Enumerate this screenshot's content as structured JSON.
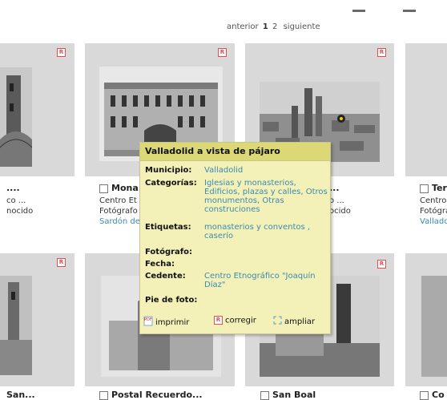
{
  "pager": {
    "prev": "anterior",
    "pages": [
      "1",
      "2"
    ],
    "next": "siguiente"
  },
  "cards_top": [
    {
      "title": "....",
      "line1": "co ...",
      "line2": "nocido",
      "line3": ""
    },
    {
      "title": "Mona",
      "line1": "Centro Et",
      "line2": "Fotógrafo",
      "line3": "Sardón de"
    },
    {
      "title": "...",
      "line1": "o ...",
      "line2": "ocido",
      "line3": ""
    },
    {
      "title": "Ter",
      "line1": "Centro",
      "line2": "Fotógra",
      "line3": "Vallado"
    }
  ],
  "cards_bottom": [
    {
      "title": "San..."
    },
    {
      "title": "Postal Recuerdo..."
    },
    {
      "title": "San Boal"
    },
    {
      "title": "Co"
    }
  ],
  "badge": "R",
  "popup": {
    "title": "Valladolid a vista de pájaro",
    "fields": [
      {
        "label": "Municipio:",
        "value": "Valladolid"
      },
      {
        "label": "Categorías:",
        "value": "Iglesias y monasterios, Edificios, plazas y calles, Otros monumentos, Otras construciones"
      },
      {
        "label": "Etiquetas:",
        "value": "monasterios y conventos , caserío"
      },
      {
        "label": "Fotógrafo:",
        "value": ""
      },
      {
        "label": "Fecha:",
        "value": ""
      },
      {
        "label": "Cedente:",
        "value": "Centro Etnográfico \"Joaquín Díaz\""
      },
      {
        "label": "Pie de foto:",
        "value": ""
      }
    ],
    "actions": {
      "print": "imprimir",
      "correct": "corregir",
      "enlarge": "ampliar"
    },
    "pdf_label": "PDF"
  },
  "colors": {
    "link": "#3a8ab0",
    "popup_bg": "#f3f1b8",
    "popup_header": "#dcd875",
    "tile": "#d9d9d9",
    "badge": "#e05050"
  },
  "icons": [
    "pdf-icon",
    "r-badge-icon",
    "expand-icon",
    "checkbox-icon"
  ]
}
